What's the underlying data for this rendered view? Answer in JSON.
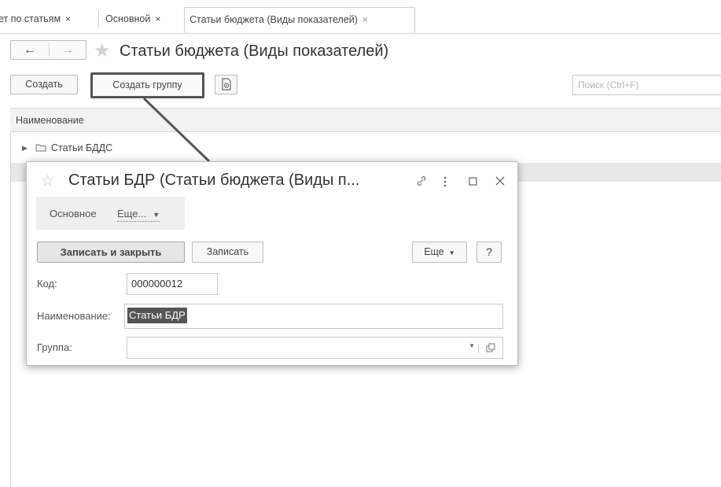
{
  "tabs": [
    {
      "label": "ет по статьям",
      "close": "×"
    },
    {
      "label": "Основной",
      "close": "×"
    },
    {
      "label": "Статьи бюджета (Виды показателей)",
      "close": "×"
    }
  ],
  "nav": {
    "back": "←",
    "forward": "→",
    "star": "★"
  },
  "page_title": "Статьи бюджета (Виды показателей)",
  "toolbar": {
    "create": "Создать",
    "create_group": "Создать группу"
  },
  "search": {
    "placeholder": "Поиск (Ctrl+F)"
  },
  "list": {
    "header": "Наименование",
    "rows": [
      {
        "label": "Статьи БДДС"
      }
    ]
  },
  "dialog": {
    "title": "Статьи БДР (Статьи бюджета (Виды п...",
    "star": "☆",
    "tabs": {
      "main": "Основное",
      "more": "Еще..."
    },
    "buttons": {
      "save_close": "Записать и закрыть",
      "save": "Записать",
      "more": "Еще",
      "help": "?"
    },
    "fields": {
      "code_label": "Код:",
      "code_value": "000000012",
      "name_label": "Наименование:",
      "name_value": "Статьи БДР",
      "group_label": "Группа:",
      "group_value": ""
    }
  }
}
